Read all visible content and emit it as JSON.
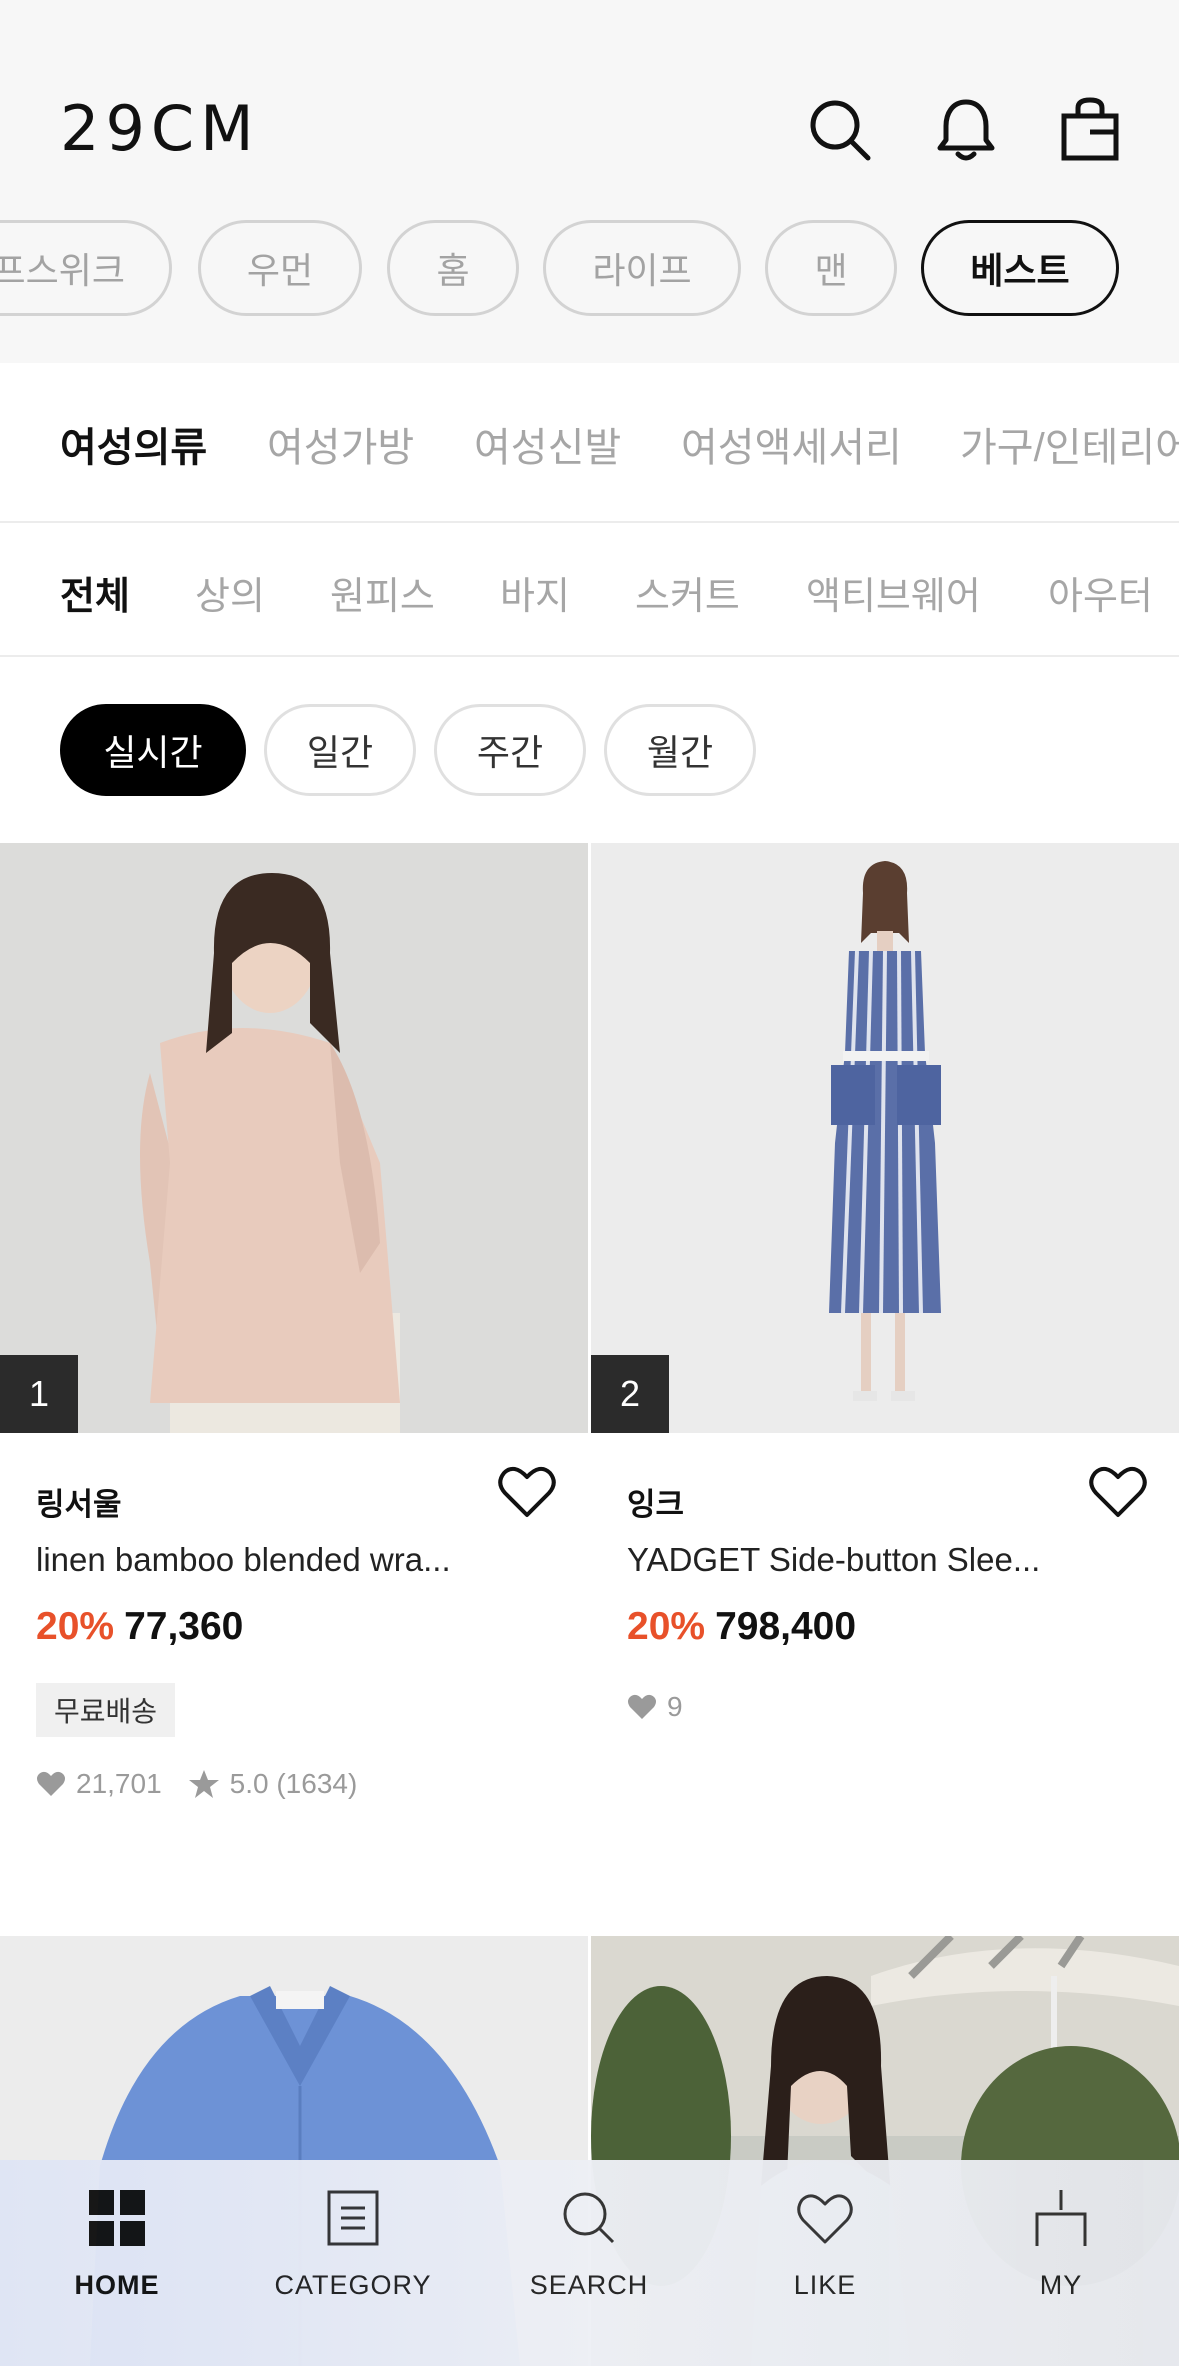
{
  "header": {
    "logo": "29CM"
  },
  "main_tabs": [
    {
      "label": "라이프스위크",
      "visible": "라이프스위크"
    },
    {
      "label": "우먼"
    },
    {
      "label": "홈"
    },
    {
      "label": "라이프"
    },
    {
      "label": "맨"
    },
    {
      "label": "베스트",
      "active": true
    }
  ],
  "categories": [
    "여성의류",
    "여성가방",
    "여성신발",
    "여성액세서리",
    "가구/인테리어"
  ],
  "subcategories": [
    "전체",
    "상의",
    "원피스",
    "바지",
    "스커트",
    "액티브웨어",
    "아우터"
  ],
  "periods": [
    "실시간",
    "일간",
    "주간",
    "월간"
  ],
  "products": [
    {
      "rank": "1",
      "brand": "링서울",
      "title": "linen bamboo blended wra...",
      "discount": "20%",
      "price": "77,360",
      "badge": "무료배송",
      "likes": "21,701",
      "rating": "5.0 (1634)"
    },
    {
      "rank": "2",
      "brand": "잉크",
      "title": "YADGET Side-button Slee...",
      "discount": "20%",
      "price": "798,400",
      "likes": "9"
    }
  ],
  "bottom_nav": [
    {
      "label": "HOME",
      "icon": "home-grid-icon",
      "active": true
    },
    {
      "label": "CATEGORY",
      "icon": "category-list-icon"
    },
    {
      "label": "SEARCH",
      "icon": "search-icon"
    },
    {
      "label": "LIKE",
      "icon": "heart-icon"
    },
    {
      "label": "MY",
      "icon": "my-page-icon"
    }
  ],
  "colors": {
    "discount": "#e8512a",
    "active_pill": "#000000",
    "header_bg": "#f7f7f7"
  }
}
